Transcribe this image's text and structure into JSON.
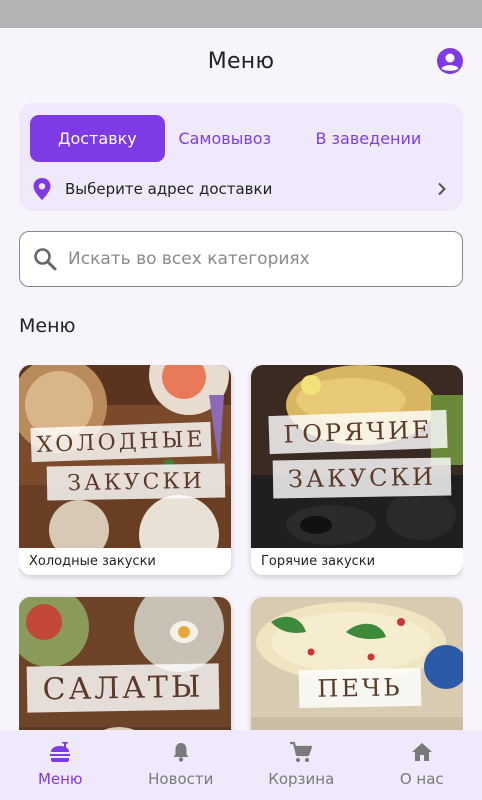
{
  "header": {
    "title": "Меню",
    "profile_icon": "account-circle-icon"
  },
  "delivery": {
    "tabs": [
      {
        "label": "Доставку",
        "active": true
      },
      {
        "label": "Самовывоз",
        "active": false
      },
      {
        "label": "В заведении",
        "active": false
      }
    ],
    "address_label": "Выберите адрес доставки",
    "pin_icon": "location-pin-icon",
    "chevron_icon": "chevron-right-icon"
  },
  "search": {
    "placeholder": "Искать во всех категориях",
    "value": "",
    "icon": "search-icon"
  },
  "section_title": "Меню",
  "categories": [
    {
      "caption": "Холодные закуски",
      "banner_lines": [
        "ХОЛОДНЫЕ",
        "ЗАКУСКИ"
      ]
    },
    {
      "caption": "Горячие закуски",
      "banner_lines": [
        "ГОРЯЧИЕ",
        "ЗАКУСКИ"
      ]
    },
    {
      "caption": "",
      "banner_lines": [
        "САЛАТЫ"
      ]
    },
    {
      "caption": "",
      "banner_lines": [
        "ПЕЧЬ"
      ]
    }
  ],
  "bottom_nav": [
    {
      "label": "Меню",
      "icon": "food-icon",
      "active": true
    },
    {
      "label": "Новости",
      "icon": "bell-icon",
      "active": false
    },
    {
      "label": "Корзина",
      "icon": "cart-icon",
      "active": false
    },
    {
      "label": "О нас",
      "icon": "home-icon",
      "active": false
    }
  ],
  "colors": {
    "accent": "#7e3ae4",
    "accent_light": "#efe9fb",
    "background": "#f7f5fb"
  }
}
